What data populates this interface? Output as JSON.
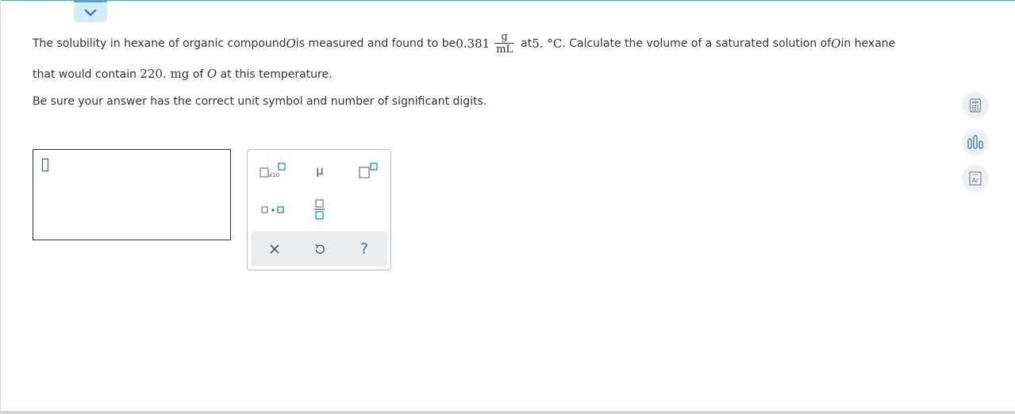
{
  "question": {
    "line1_part1": "The solubility in hexane of organic compound ",
    "compound": "O",
    "line1_part2": " is measured and found to be ",
    "solubility_value": "0.381",
    "unit_numerator": "g",
    "unit_denominator": "mL",
    "line1_part3": " at ",
    "temperature": "5. °C",
    "line1_part4": ". Calculate the volume of a saturated solution of ",
    "line1_part5": " in hexane",
    "line2_part1": "that would contain ",
    "mass_value": "220. mg",
    "line2_part2": " of ",
    "line2_part3": " at this temperature.",
    "instruction": "Be sure your answer has the correct unit symbol and number of significant digits."
  },
  "palette": {
    "x10_label": "x10",
    "mu_label": "μ",
    "help_label": "?"
  },
  "periodic_table_label": "Ar",
  "colors": {
    "accent": "#3bb5a8",
    "tab_bg": "#d3ecf5",
    "palette_box": "#2fa3c9",
    "footer_bg": "#e8edf0"
  }
}
